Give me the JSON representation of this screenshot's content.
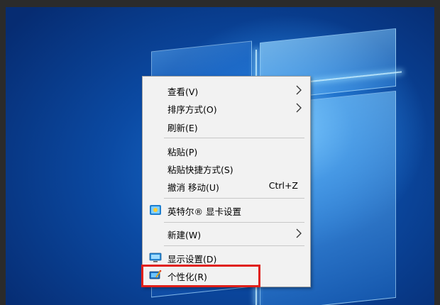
{
  "menu": {
    "items": [
      {
        "label": "查看(V)",
        "has_submenu": true
      },
      {
        "label": "排序方式(O)",
        "has_submenu": true
      },
      {
        "label": "刷新(E)"
      },
      {
        "label": "粘贴(P)"
      },
      {
        "label": "粘贴快捷方式(S)"
      },
      {
        "label": "撤消 移动(U)",
        "shortcut": "Ctrl+Z"
      },
      {
        "label": "英特尔® 显卡设置",
        "icon": "intel-graphics-icon"
      },
      {
        "label": "新建(W)",
        "has_submenu": true
      },
      {
        "label": "显示设置(D)",
        "icon": "display-settings-icon"
      },
      {
        "label": "个性化(R)",
        "icon": "personalize-icon"
      }
    ]
  },
  "annotation": {
    "highlight_color": "#e0201a",
    "highlighted_item": "个性化(R)"
  },
  "colors": {
    "menu_background": "#f2f2f2",
    "desktop_blue": "#0b4aa3"
  }
}
